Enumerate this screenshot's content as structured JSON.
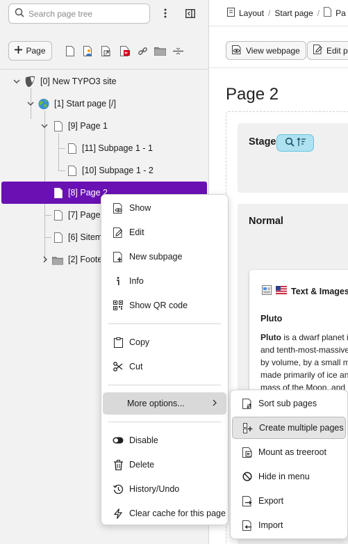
{
  "tree": {
    "search_placeholder": "Search page tree",
    "new_page_label": "Page",
    "nodes": [
      {
        "label": "[0] New TYPO3 site"
      },
      {
        "label": "[1] Start page [/]"
      },
      {
        "label": "[9] Page 1"
      },
      {
        "label": "[11] Subpage 1 - 1"
      },
      {
        "label": "[10] Subpage 1 - 2"
      },
      {
        "label": "[8] Page 2"
      },
      {
        "label": "[7] Page"
      },
      {
        "label": "[6] Sitem"
      },
      {
        "label": "[2] Foote"
      }
    ]
  },
  "breadcrumb": {
    "items": [
      "Layout",
      "Start page",
      "Pa"
    ]
  },
  "docheader": {
    "view_webpage_label": "View webpage",
    "edit_label": "Edit pa"
  },
  "content": {
    "page_title": "Page 2",
    "stage_label": "Stage",
    "normal_label": "Normal",
    "element": {
      "header": "Text & Images",
      "subtitle": "Pluto",
      "body_bold": "Pluto",
      "body_lines": [
        " is a dwarf planet i",
        "and tenth-most-massive",
        "by volume, by a small m",
        "made primarily of ice an",
        "mass of the Moon, and"
      ]
    }
  },
  "context_menu": {
    "items": [
      {
        "label": "Show"
      },
      {
        "label": "Edit"
      },
      {
        "label": "New subpage"
      },
      {
        "label": "Info"
      },
      {
        "label": "Show QR code"
      },
      {
        "label": "Copy"
      },
      {
        "label": "Cut"
      },
      {
        "label": "More options..."
      },
      {
        "label": "Disable"
      },
      {
        "label": "Delete"
      },
      {
        "label": "History/Undo"
      },
      {
        "label": "Clear cache for this page"
      }
    ]
  },
  "sub_menu": {
    "items": [
      {
        "label": "Sort sub pages"
      },
      {
        "label": "Create multiple pages"
      },
      {
        "label": "Mount as treeroot"
      },
      {
        "label": "Hide in menu"
      },
      {
        "label": "Export"
      },
      {
        "label": "Import"
      }
    ]
  },
  "colors": {
    "selected_row": "#6a11b4",
    "stage_badge": "#aee2f0",
    "flag_red": "#c8102e"
  }
}
